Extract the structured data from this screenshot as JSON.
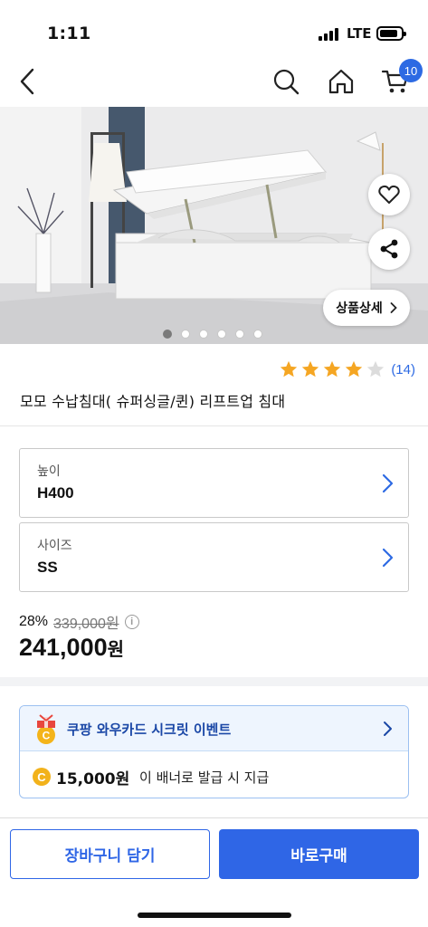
{
  "status_bar": {
    "time": "1:11",
    "network": "LTE",
    "icons": [
      "signal-icon",
      "battery-icon"
    ]
  },
  "header": {
    "icons": [
      "back-arrow-icon",
      "search-icon",
      "home-icon",
      "cart-icon"
    ],
    "cart_count": "10"
  },
  "hero": {
    "detail_button_label": "상품상세",
    "slide_count": 6,
    "active_slide": 1,
    "icons": [
      "heart-icon",
      "share-icon",
      "chevron-right-icon"
    ]
  },
  "product": {
    "rating": 4,
    "rating_max": 5,
    "review_count": "(14)",
    "title": "모모 수납침대( 슈퍼싱글/퀸) 리프트업 침대"
  },
  "options": [
    {
      "label": "높이",
      "value": "H400"
    },
    {
      "label": "사이즈",
      "value": "SS"
    }
  ],
  "price": {
    "discount": "28%",
    "original": "339,000원",
    "sale_amount": "241,000",
    "sale_unit": "원"
  },
  "promo": {
    "title": "쿠팡 와우카드 시크릿 이벤트",
    "coin_symbol": "C",
    "amount": "15,000원",
    "description": "이 배너로 발급 시 지급"
  },
  "actions": {
    "cart_label": "장바구니 담기",
    "buy_label": "바로구매"
  },
  "colors": {
    "accent": "#2f66e6",
    "badge": "#2d6ae3",
    "star": "#f5a623",
    "promo_text": "#1a47a6",
    "coin": "#f2b21b"
  }
}
